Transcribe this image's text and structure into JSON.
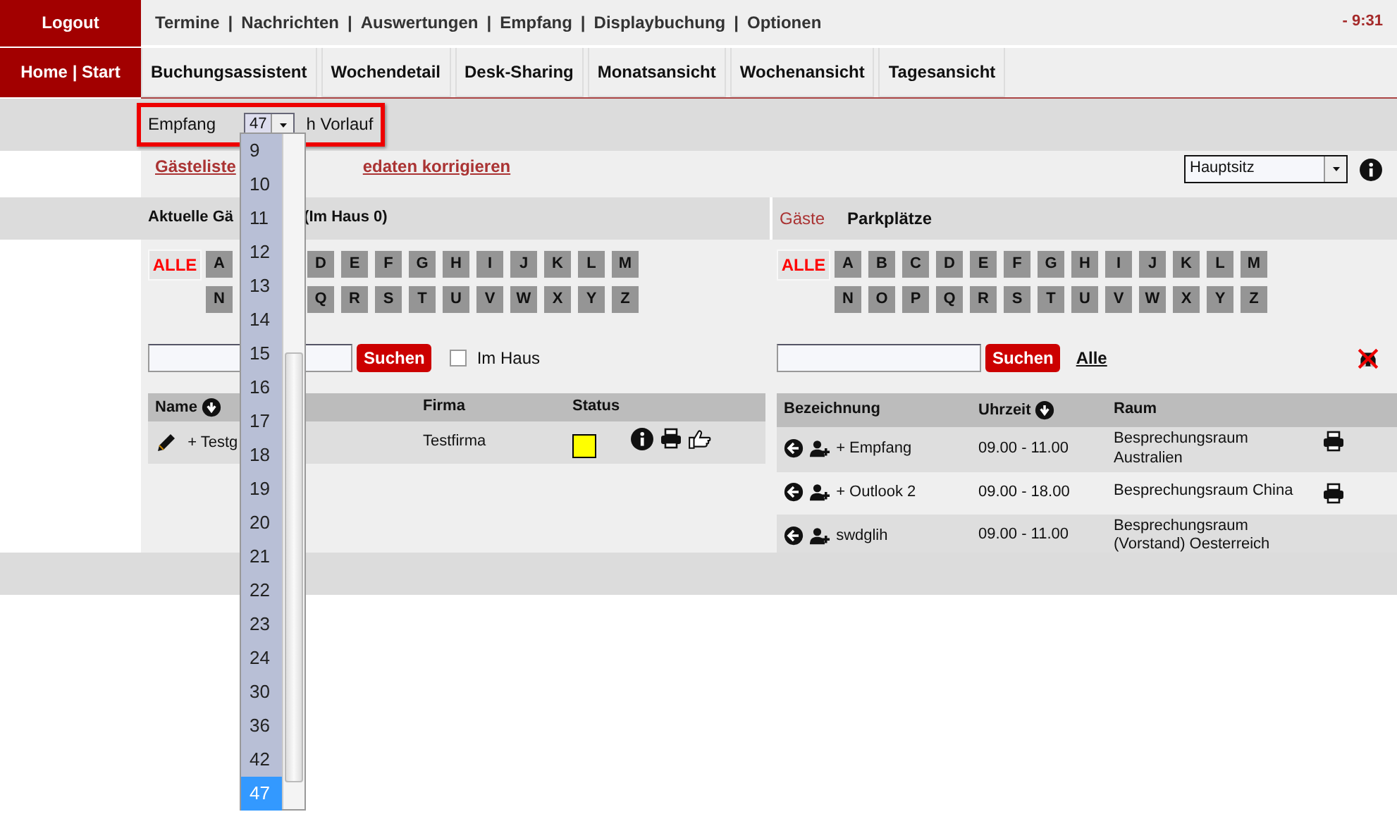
{
  "sidebar": {
    "logout": "Logout",
    "home": "Home | Start"
  },
  "top_menu": [
    {
      "kind": "link",
      "label": "Termine"
    },
    {
      "kind": "sep",
      "label": "|"
    },
    {
      "kind": "link",
      "label": "Nachrichten"
    },
    {
      "kind": "sep",
      "label": "|"
    },
    {
      "kind": "link",
      "label": "Auswertungen"
    },
    {
      "kind": "sep",
      "label": "|"
    },
    {
      "kind": "link",
      "label": "Empfang"
    },
    {
      "kind": "sep",
      "label": "|"
    },
    {
      "kind": "link",
      "label": "Displaybuchung"
    },
    {
      "kind": "sep",
      "label": "|"
    },
    {
      "kind": "link",
      "label": "Optionen"
    }
  ],
  "clock": "- 9:31",
  "tabs": [
    "Buchungsassistent",
    "Wochendetail",
    "Desk-Sharing",
    "Monatsansicht",
    "Wochenansicht",
    "Tagesansicht"
  ],
  "hours_filter": {
    "label": "Empfang",
    "value": "47",
    "suffix": "h Vorlauf",
    "options": [
      {
        "label": "9",
        "selected": false
      },
      {
        "label": "10",
        "selected": false
      },
      {
        "label": "11",
        "selected": false
      },
      {
        "label": "12",
        "selected": false
      },
      {
        "label": "13",
        "selected": false
      },
      {
        "label": "14",
        "selected": false
      },
      {
        "label": "15",
        "selected": false
      },
      {
        "label": "16",
        "selected": false
      },
      {
        "label": "17",
        "selected": false
      },
      {
        "label": "18",
        "selected": false
      },
      {
        "label": "19",
        "selected": false
      },
      {
        "label": "20",
        "selected": false
      },
      {
        "label": "21",
        "selected": false
      },
      {
        "label": "22",
        "selected": false
      },
      {
        "label": "23",
        "selected": false
      },
      {
        "label": "24",
        "selected": false
      },
      {
        "label": "30",
        "selected": false
      },
      {
        "label": "36",
        "selected": false
      },
      {
        "label": "42",
        "selected": false
      },
      {
        "label": "47",
        "selected": true
      }
    ]
  },
  "links": [
    "Gästeliste",
    "edaten korrigieren"
  ],
  "location_select": {
    "value": "Hauptsitz"
  },
  "guests_panel": {
    "title": "Aktuelle Gä",
    "title_tail": "(Im Haus 0)",
    "all_button": "ALLE",
    "letter_rows": [
      [
        "A",
        "D",
        "E",
        "F",
        "G",
        "H",
        "I",
        "J",
        "K",
        "L",
        "M"
      ],
      [
        "N",
        "Q",
        "R",
        "S",
        "T",
        "U",
        "V",
        "W",
        "X",
        "Y",
        "Z"
      ]
    ],
    "search_button": "Suchen",
    "in_house": {
      "label": "Im Haus",
      "checked": false
    },
    "columns": [
      "Name",
      "Firma",
      "Status"
    ],
    "rows": [
      {
        "name": "+ Testg",
        "company": "Testfirma",
        "color": "#ffff00"
      }
    ]
  },
  "rooms_panel": {
    "tabs": [
      {
        "label": "Gäste",
        "selected": false
      },
      {
        "label": "Parkplätze",
        "selected": true
      }
    ],
    "all_button": "ALLE",
    "letter_rows": [
      [
        "A",
        "B",
        "C",
        "D",
        "E",
        "F",
        "G",
        "H",
        "I",
        "J",
        "K",
        "L",
        "M"
      ],
      [
        "N",
        "O",
        "P",
        "Q",
        "R",
        "S",
        "T",
        "U",
        "V",
        "W",
        "X",
        "Y",
        "Z"
      ]
    ],
    "search_button": "Suchen",
    "all_link": "Alle",
    "columns": [
      "Bezeichnung",
      "Uhrzeit",
      "Raum"
    ],
    "rows": [
      {
        "name": "+ Empfang",
        "time": "09.00 - 11.00",
        "room": "Besprechungsraum Australien",
        "printable": true
      },
      {
        "name": "+ Outlook 2",
        "time": "09.00 - 18.00",
        "room": "Besprechungsraum China",
        "printable": true
      },
      {
        "name": "swdglih",
        "time": "09.00 - 11.00",
        "room": "Besprechungsraum (Vorstand) Oesterreich",
        "printable": false
      }
    ]
  }
}
